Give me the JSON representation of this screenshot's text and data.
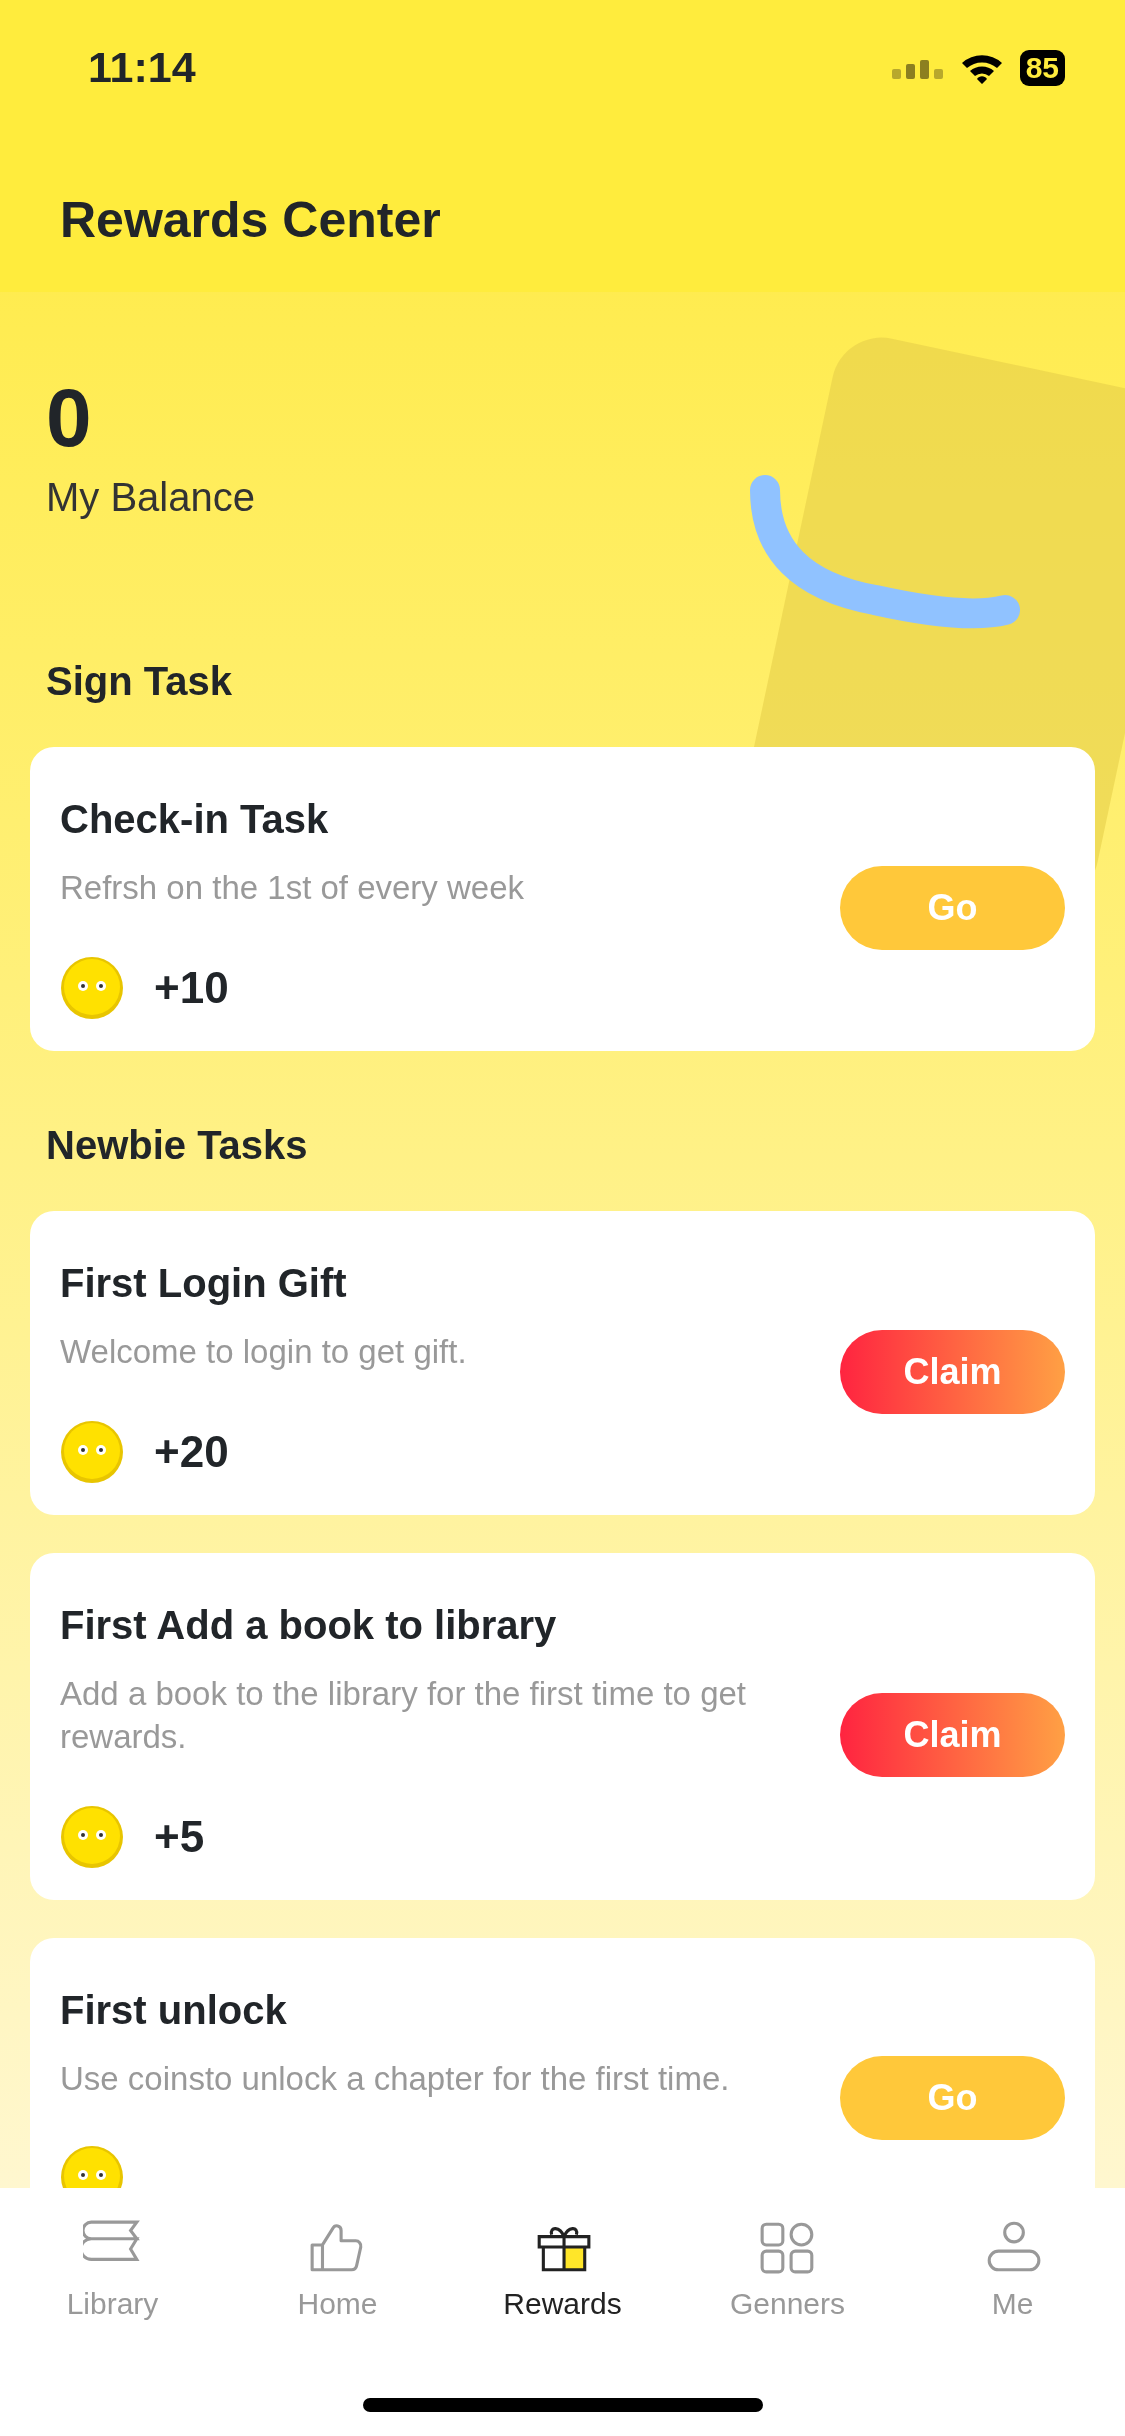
{
  "status_bar": {
    "time": "11:14",
    "battery": "85"
  },
  "header": {
    "title": "Rewards Center"
  },
  "balance": {
    "amount": "0",
    "label": "My Balance"
  },
  "sections": [
    {
      "title": "Sign Task",
      "tasks": [
        {
          "title": "Check-in Task",
          "description": "Refrsh on the 1st of every week",
          "reward": "+10",
          "button": {
            "label": "Go",
            "kind": "go"
          }
        }
      ]
    },
    {
      "title": "Newbie Tasks",
      "tasks": [
        {
          "title": "First Login Gift",
          "description": "Welcome to login to get gift.",
          "reward": "+20",
          "button": {
            "label": "Claim",
            "kind": "claim"
          }
        },
        {
          "title": "First Add a book to library",
          "description": "Add a book to the library for the first time to get rewards.",
          "reward": "+5",
          "button": {
            "label": "Claim",
            "kind": "claim"
          }
        },
        {
          "title": "First unlock",
          "description": "Use coinsto unlock a chapter for the first time.",
          "button": {
            "label": "Go",
            "kind": "go"
          }
        }
      ]
    }
  ],
  "tab_bar": [
    {
      "label": "Library",
      "selected": false
    },
    {
      "label": "Home",
      "selected": false
    },
    {
      "label": "Rewards",
      "selected": true
    },
    {
      "label": "Genners",
      "selected": false
    },
    {
      "label": "Me",
      "selected": false
    }
  ]
}
